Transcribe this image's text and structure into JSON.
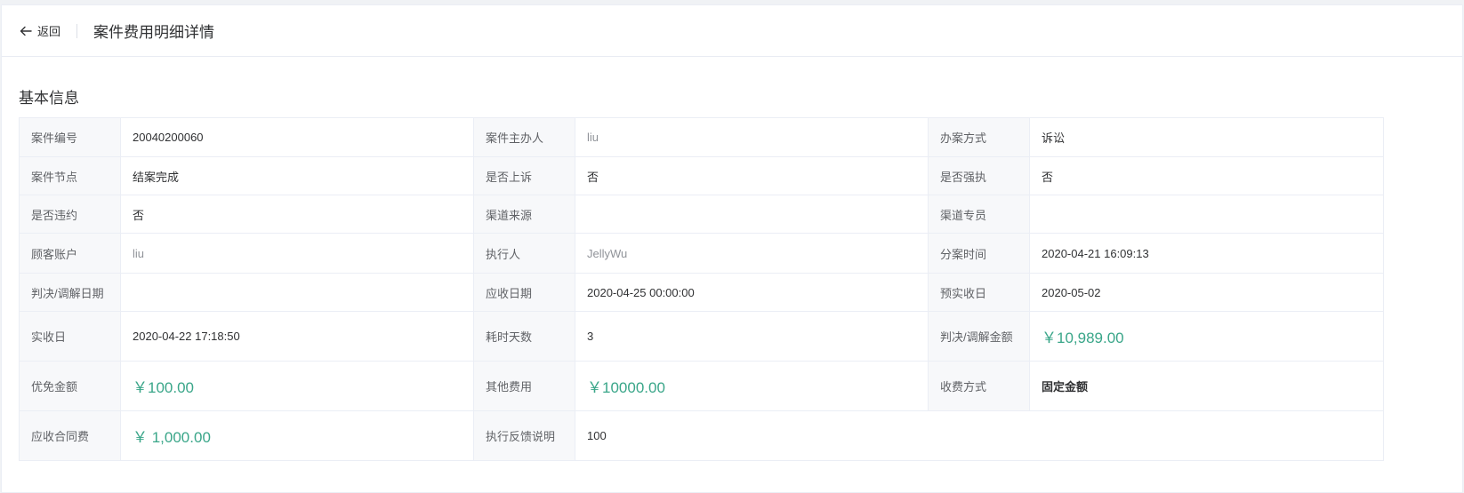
{
  "header": {
    "back_label": "返回",
    "title": "案件费用明细详情"
  },
  "section": {
    "title": "基本信息"
  },
  "rows": [
    [
      {
        "label": "案件编号",
        "value": "20040200060"
      },
      {
        "label": "案件主办人",
        "value": "liu"
      },
      {
        "label": "办案方式",
        "value": "诉讼"
      }
    ],
    [
      {
        "label": "案件节点",
        "value": "结案完成"
      },
      {
        "label": "是否上诉",
        "value": "否"
      },
      {
        "label": "是否强执",
        "value": "否"
      }
    ],
    [
      {
        "label": "是否违约",
        "value": "否"
      },
      {
        "label": "渠道来源",
        "value": ""
      },
      {
        "label": "渠道专员",
        "value": ""
      }
    ],
    [
      {
        "label": "顾客账户",
        "value": "liu"
      },
      {
        "label": "执行人",
        "value": "JellyWu"
      },
      {
        "label": "分案时间",
        "value": "2020-04-21 16:09:13"
      }
    ],
    [
      {
        "label": "判决/调解日期",
        "value": ""
      },
      {
        "label": "应收日期",
        "value": "2020-04-25 00:00:00"
      },
      {
        "label": "预实收日",
        "value": "2020-05-02"
      }
    ],
    [
      {
        "label": "实收日",
        "value": "2020-04-22 17:18:50"
      },
      {
        "label": "耗时天数",
        "value": "3"
      },
      {
        "label": "判决/调解金额",
        "value": "￥10,989.00"
      }
    ],
    [
      {
        "label": "优免金额",
        "value": "￥100.00"
      },
      {
        "label": "其他费用",
        "value": "￥10000.00"
      },
      {
        "label": "收费方式",
        "value": "固定金额"
      }
    ],
    [
      {
        "label": "应收合同费",
        "value": "￥ 1,000.00"
      },
      {
        "label": "执行反馈说明",
        "value": "100"
      }
    ]
  ],
  "colors": {
    "money": "#3aa689",
    "label_bg": "#f7f8fa",
    "border": "#ebeef5"
  }
}
